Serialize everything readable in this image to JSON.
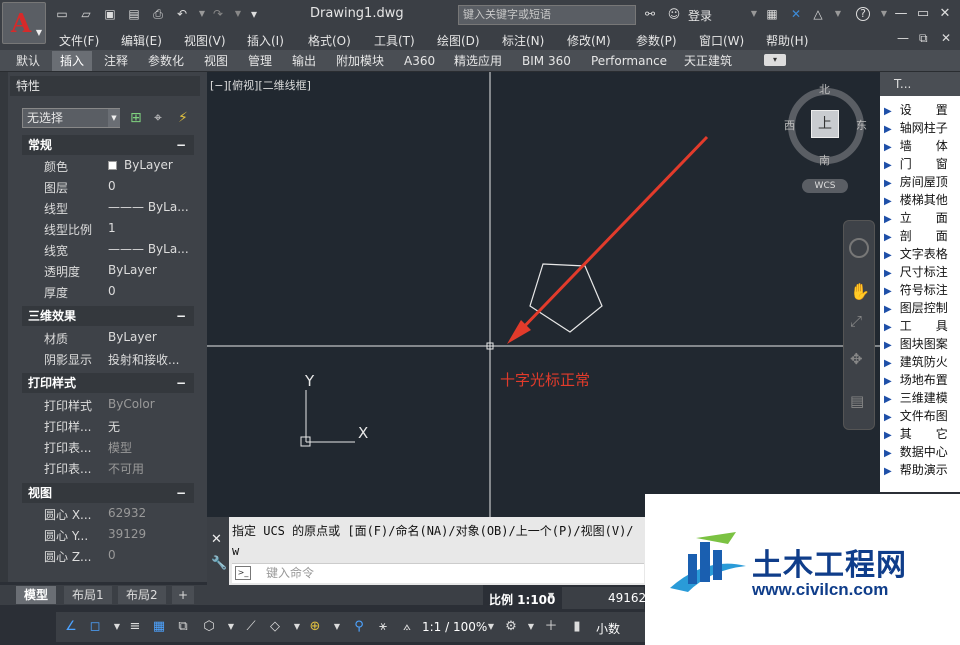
{
  "app": {
    "logo_letter": "A",
    "document_title": "Drawing1.dwg",
    "search_placeholder": "键入关键字或短语",
    "login_label": "登录",
    "help_label": "?"
  },
  "menu": [
    "文件(F)",
    "编辑(E)",
    "视图(V)",
    "插入(I)",
    "格式(O)",
    "工具(T)",
    "绘图(D)",
    "标注(N)",
    "修改(M)",
    "参数(P)",
    "窗口(W)",
    "帮助(H)"
  ],
  "ribbon_tabs": [
    "默认",
    "插入",
    "注释",
    "参数化",
    "视图",
    "管理",
    "输出",
    "附加模块",
    "A360",
    "精选应用",
    "BIM 360",
    "Performance",
    "天正建筑"
  ],
  "ribbon_active": "插入",
  "properties": {
    "title": "特性",
    "selection": "无选择",
    "sections": [
      {
        "title": "常规",
        "toggle": "−",
        "rows": [
          {
            "key": "颜色",
            "value": "ByLayer",
            "swatch": "#ffffff"
          },
          {
            "key": "图层",
            "value": "0"
          },
          {
            "key": "线型",
            "value": "——— ByLa..."
          },
          {
            "key": "线型比例",
            "value": "1"
          },
          {
            "key": "线宽",
            "value": "——— ByLa..."
          },
          {
            "key": "透明度",
            "value": "ByLayer"
          },
          {
            "key": "厚度",
            "value": "0"
          }
        ]
      },
      {
        "title": "三维效果",
        "toggle": "−",
        "rows": [
          {
            "key": "材质",
            "value": "ByLayer"
          },
          {
            "key": "阴影显示",
            "value": "投射和接收..."
          }
        ]
      },
      {
        "title": "打印样式",
        "toggle": "−",
        "rows": [
          {
            "key": "打印样式",
            "value": "ByColor",
            "dim": true
          },
          {
            "key": "打印样...",
            "value": "无"
          },
          {
            "key": "打印表...",
            "value": "模型",
            "dim": true
          },
          {
            "key": "打印表...",
            "value": "不可用",
            "dim": true
          }
        ]
      },
      {
        "title": "视图",
        "toggle": "−",
        "rows": [
          {
            "key": "圆心 X...",
            "value": "62932",
            "dim": true
          },
          {
            "key": "圆心 Y...",
            "value": "39129",
            "dim": true
          },
          {
            "key": "圆心 Z...",
            "value": "0",
            "dim": true
          }
        ]
      }
    ]
  },
  "viewport": {
    "label": "[−][俯视][二维线框]",
    "annotation": "十字光标正常",
    "ucs_x": "X",
    "ucs_y": "Y"
  },
  "viewcube": {
    "north": "北",
    "south": "南",
    "east": "东",
    "west": "西",
    "face": "上",
    "wcs": "WCS"
  },
  "tool_palette": {
    "title": "T...",
    "items": [
      "设　　置",
      "轴网柱子",
      "墙　　体",
      "门　　窗",
      "房间屋顶",
      "楼梯其他",
      "立　　面",
      "剖　　面",
      "文字表格",
      "尺寸标注",
      "符号标注",
      "图层控制",
      "工　　具",
      "图块图案",
      "建筑防火",
      "场地布置",
      "三维建模",
      "文件布图",
      "其　　它",
      "数据中心",
      "帮助演示"
    ]
  },
  "command": {
    "history": "指定 UCS 的原点或 [面(F)/命名(NA)/对象(OB)/上一个(P)/视图(V)/",
    "history2": "w",
    "placeholder": "键入命令"
  },
  "layout_tabs": [
    "模型",
    "布局1",
    "布局2",
    "+"
  ],
  "status": {
    "scale": "比例 1:100",
    "coords": "49162",
    "annoscale": "1:1 / 100%",
    "units": "小数"
  },
  "watermark": {
    "name": "土木工程网",
    "url": "www.civilcn.com"
  }
}
